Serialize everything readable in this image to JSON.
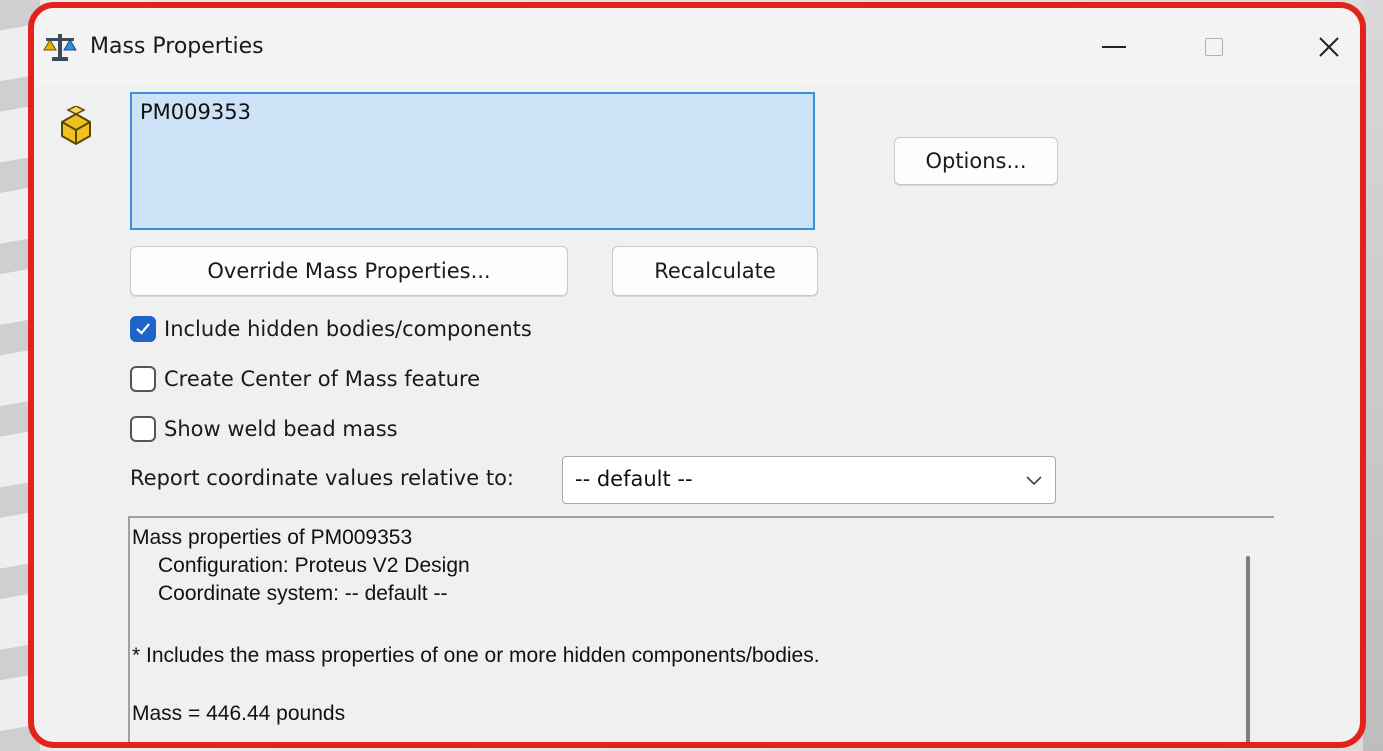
{
  "window": {
    "title": "Mass Properties",
    "controls": {
      "minimize": "minimize",
      "maximize": "maximize",
      "close": "close"
    }
  },
  "selection": {
    "items": [
      "PM009353"
    ]
  },
  "buttons": {
    "options": "Options...",
    "override": "Override Mass Properties...",
    "recalculate": "Recalculate"
  },
  "checkboxes": [
    {
      "label": "Include hidden bodies/components",
      "checked": true
    },
    {
      "label": "Create Center of Mass feature",
      "checked": false
    },
    {
      "label": "Show weld bead mass",
      "checked": false
    }
  ],
  "report": {
    "label": "Report coordinate values relative to:",
    "selected": "-- default --"
  },
  "results": {
    "lines": [
      "Mass properties of PM009353",
      "Configuration: Proteus V2 Design",
      "Coordinate system: -- default --",
      "* Includes the mass properties of one or more hidden components/bodies.",
      "Mass = 446.44 pounds"
    ]
  },
  "colors": {
    "highlight_border": "#e0241b",
    "selection_fill": "#cce3f7",
    "selection_border": "#3a8fdc",
    "checkbox_checked": "#1c64c9"
  }
}
